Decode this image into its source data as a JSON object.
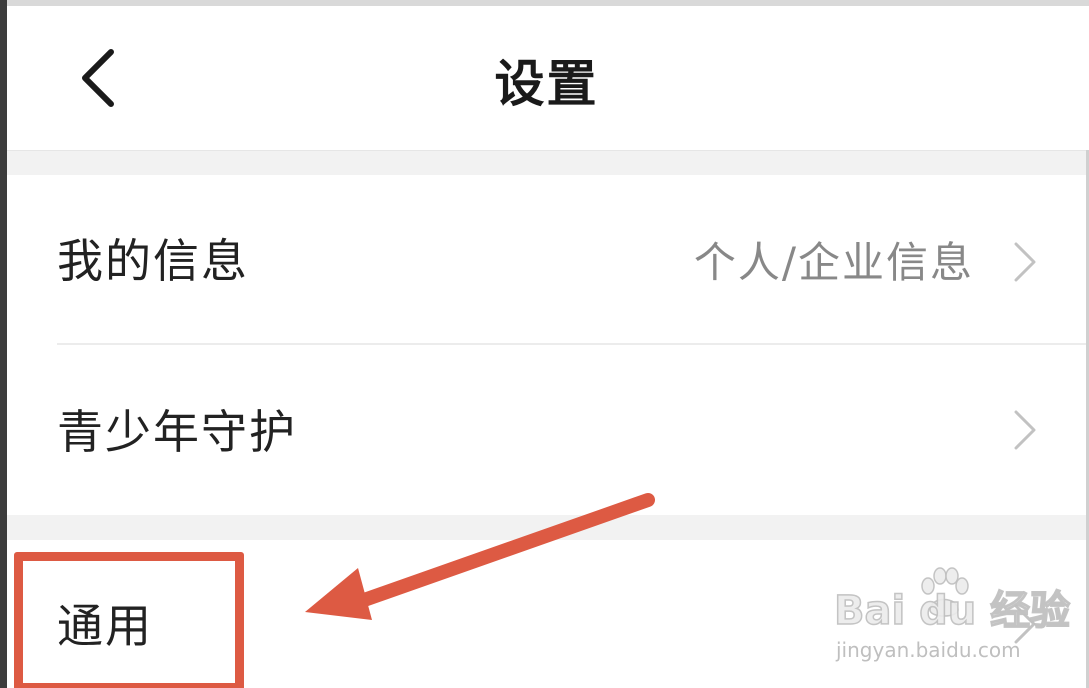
{
  "header": {
    "title": "设置",
    "back_icon": "chevron-left-icon"
  },
  "settings": {
    "items": [
      {
        "label": "我的信息",
        "value": "个人/企业信息",
        "icon": "chevron-right-icon"
      },
      {
        "label": "青少年守护",
        "value": "",
        "icon": "chevron-right-icon"
      },
      {
        "label": "通用",
        "value": "",
        "icon": "chevron-right-icon"
      }
    ]
  },
  "annotation": {
    "color": "#dd5a43"
  },
  "watermark": {
    "brand": "Bai du 经验",
    "url": "jingyan.baidu.com",
    "icon": "paw-icon"
  }
}
